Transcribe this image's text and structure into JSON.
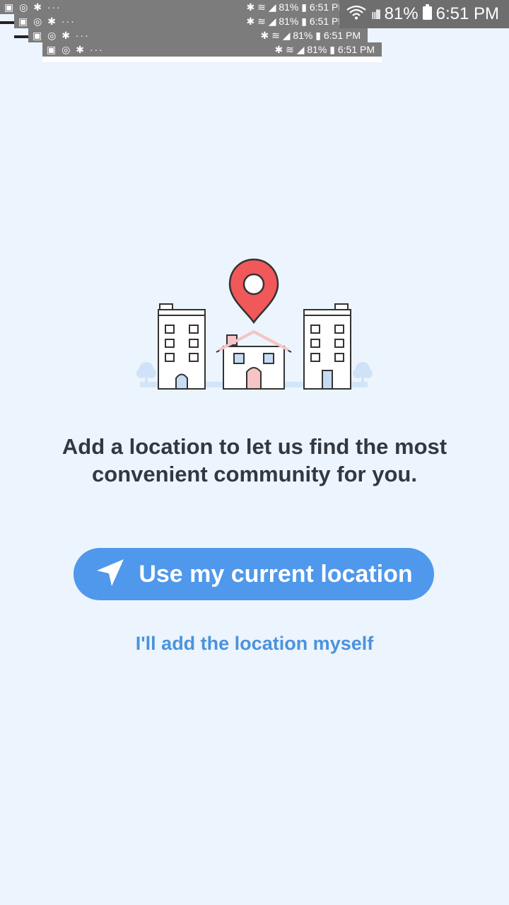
{
  "status_bars": [
    {
      "left_icons": "▣ ◎ ✱ ···",
      "right": "✱ ≋ ◢ 81% ▮ 6:51 PM"
    },
    {
      "left_icons": "▣ ◎ ✱ ···",
      "right": "✱ ≋ ◢ 81% ▮ 6:51 PM"
    },
    {
      "left_icons": "▣ ◎ ✱ ···",
      "right": "✱ ≋ ◢ 81% ▮ 6:51 PM"
    },
    {
      "left_icons": "▣ ◎ ✱ ···",
      "right": "✱ ≋ ◢ 81% ▮ 6:51 PM"
    }
  ],
  "status_bar": {
    "signal": "ıılll",
    "battery_percent": "81%",
    "time": "6:51 PM"
  },
  "onboarding": {
    "message": "Add a location to let us find the most convenient community for you.",
    "primary_button_label": "Use my current location",
    "secondary_link_label": "I'll add the location myself"
  },
  "colors": {
    "background": "#ecf4fd",
    "accent": "#4f98eb",
    "link": "#4b93dc",
    "pin": "#f0585a"
  }
}
